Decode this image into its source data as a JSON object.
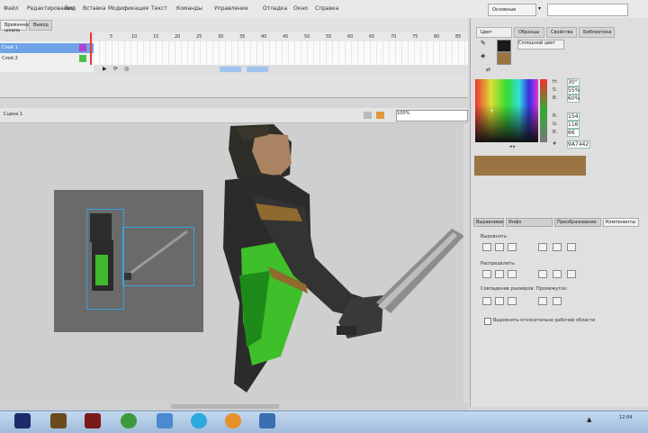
{
  "menubar": {
    "items": [
      "Файл",
      "Редактирование",
      "Вид",
      "Вставка",
      "Модификация",
      "Текст",
      "Команды",
      "Управление",
      "Отладка",
      "Окно",
      "Справка"
    ],
    "workspace": "Основные"
  },
  "timeline": {
    "tabs": [
      "Временная шкала",
      "Вывод"
    ],
    "layers": [
      "Слой 1",
      "Слой 2"
    ],
    "frame_numbers": [
      "5",
      "10",
      "15",
      "20",
      "25",
      "30",
      "35",
      "40",
      "45",
      "50",
      "55",
      "60",
      "65",
      "70",
      "75",
      "80",
      "85"
    ]
  },
  "stage": {
    "scene": "Сцена 1",
    "zoom": "100%"
  },
  "color_panel": {
    "tabs": [
      "Цвет",
      "Образцы",
      "Свойства",
      "Библиотека"
    ],
    "type": "Сплошной цвет",
    "hsb_labels": [
      "H:",
      "S:",
      "B:"
    ],
    "rgb_labels": [
      "R:",
      "G:",
      "B:"
    ],
    "values": [
      "30°",
      "55%",
      "60%",
      "154",
      "116",
      "66"
    ],
    "hex": "9A7442",
    "colors": {
      "fill": "#1b1b1b",
      "stroke": "#9a7442",
      "swatch": "#9a7442"
    }
  },
  "transform_panel": {
    "tabs": [
      "Выравнивание",
      "Инфо",
      "Преобразование",
      "Компоненты"
    ],
    "sections": [
      "Выровнять:",
      "Распределить:",
      "Совпадение размеров:",
      "Промежуток:"
    ],
    "checkbox_label": "Выровнять относительно рабочей области"
  },
  "taskbar": {
    "icons": [
      "start-icon",
      "flash-icon",
      "illustrator-icon",
      "photoshop-icon",
      "chrome-icon",
      "explorer-icon",
      "skype-icon",
      "firefox-icon",
      "network-icon"
    ],
    "time": "12:04"
  }
}
